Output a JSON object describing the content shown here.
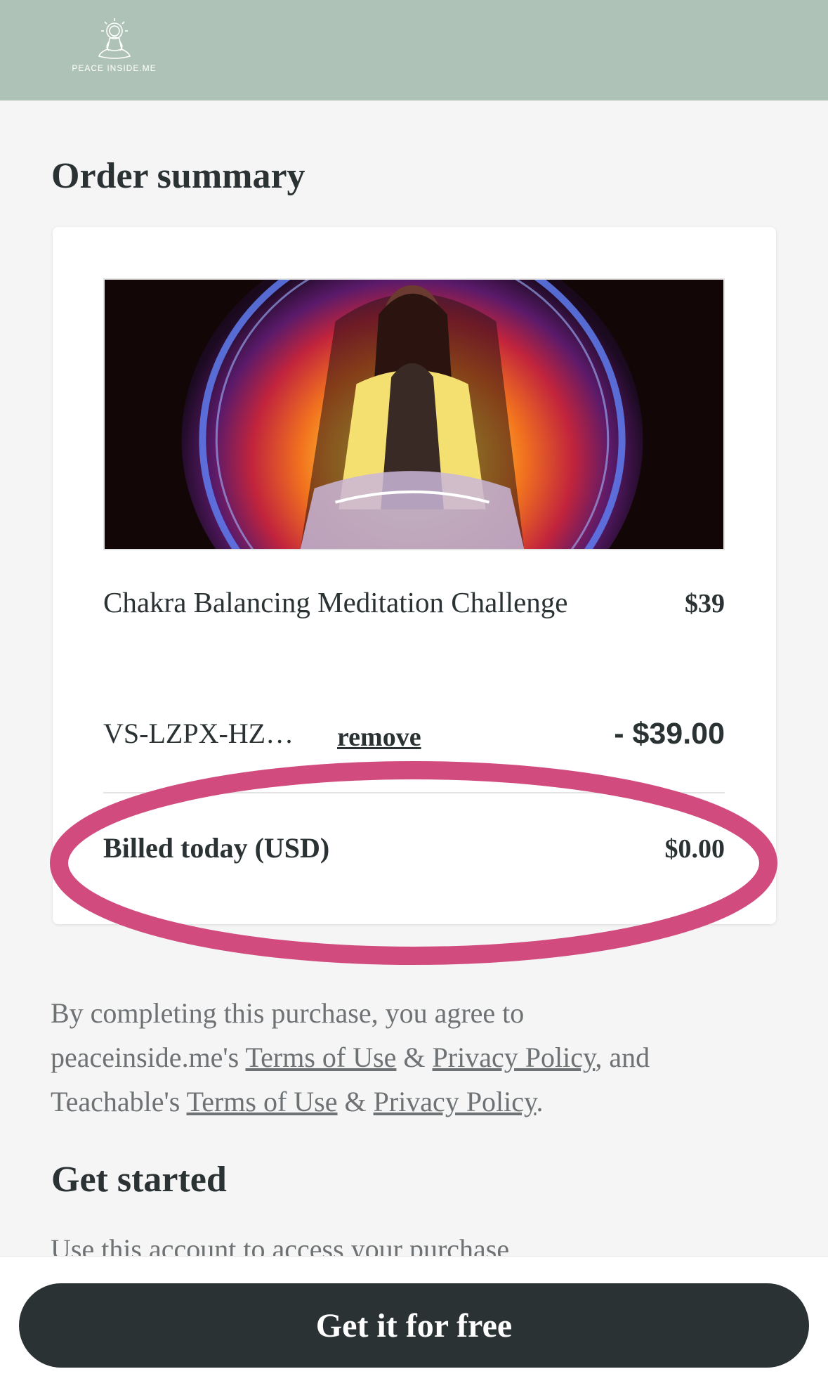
{
  "header": {
    "brand": "PEACE INSIDE.ME",
    "background_color": "#aec2b8"
  },
  "order_summary": {
    "title": "Order summary",
    "product": {
      "name": "Chakra Balancing Meditation Challenge",
      "price": "$39"
    },
    "coupon": {
      "code": "VS-LZPX-HZ…",
      "remove_label": "remove",
      "discount": "- $39.00"
    },
    "billed": {
      "label": "Billed today (USD)",
      "amount": "$0.00"
    },
    "highlight_color": "#d24b7e"
  },
  "legal": {
    "intro": "By completing this purchase, you agree to",
    "merchant": "peaceinside.me's",
    "platform": "Teachable's",
    "terms_label": "Terms of Use",
    "privacy_label": "Privacy Policy",
    "amp": "&",
    "and": ", and"
  },
  "get_started": {
    "title": "Get started",
    "subtitle": "Use this account to access your purchase"
  },
  "cta": {
    "label": "Get it for free"
  }
}
